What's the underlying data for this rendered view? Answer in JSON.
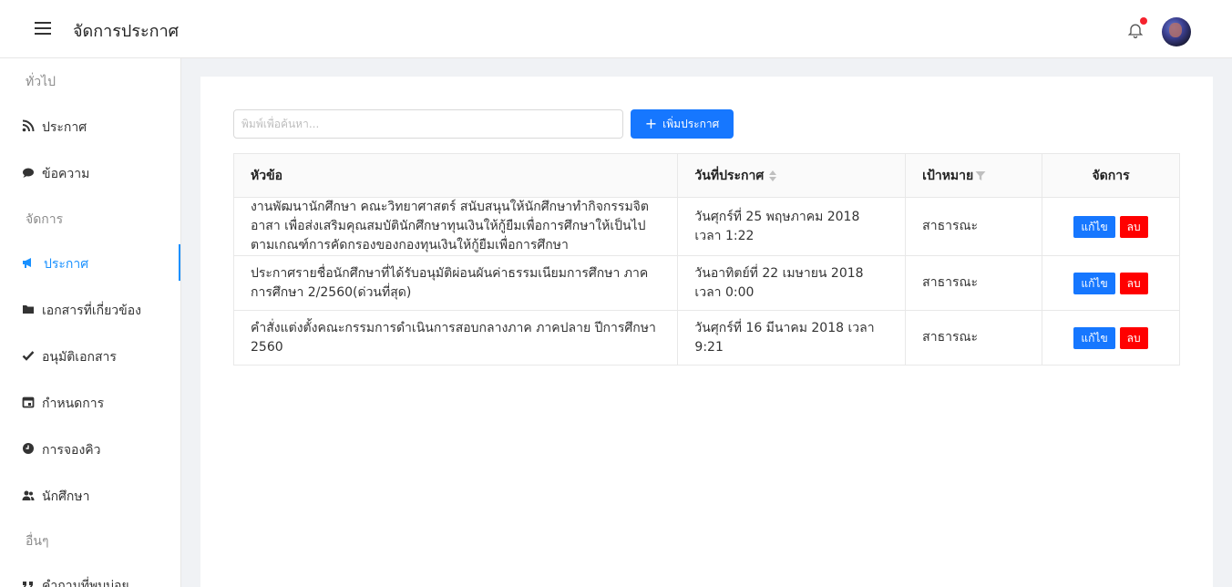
{
  "header": {
    "title": "จัดการประกาศ"
  },
  "sidebar": {
    "groups": [
      "ทั่วไป",
      "จัดการ",
      "อื่นๆ"
    ],
    "items": [
      {
        "label": "ประกาศ",
        "icon": "rss-icon"
      },
      {
        "label": "ข้อความ",
        "icon": "message-icon"
      },
      {
        "label": "ประกาศ",
        "icon": "megaphone-icon",
        "active": true
      },
      {
        "label": "เอกสารที่เกี่ยวข้อง",
        "icon": "folder-icon"
      },
      {
        "label": "อนุมัติเอกสาร",
        "icon": "check-icon"
      },
      {
        "label": "กำหนดการ",
        "icon": "calendar-icon"
      },
      {
        "label": "การจองคิว",
        "icon": "clock-icon"
      },
      {
        "label": "นักศึกษา",
        "icon": "users-icon"
      },
      {
        "label": "คำถามที่พบบ่อย",
        "icon": "quote-icon"
      }
    ]
  },
  "toolbar": {
    "search_placeholder": "พิมพ์เพื่อค้นหา...",
    "add_label": "เพิ่มประกาศ"
  },
  "table": {
    "headers": [
      "หัวข้อ",
      "วันที่ประกาศ",
      "เป้าหมาย",
      "จัดการ"
    ],
    "edit_label": "แก้ไข",
    "delete_label": "ลบ",
    "rows": [
      {
        "title": "งานพัฒนานักศึกษา คณะวิทยาศาสตร์ สนับสนุนให้นักศึกษาทำกิจกรรมจิตอาสา เพื่อส่งเสริมคุณสมบัตินักศึกษาทุนเงินให้กู้ยืมเพื่อการศึกษาให้เป็นไปตามเกณฑ์การคัดกรองของกองทุนเงินให้กู้ยืมเพื่อการศึกษา",
        "date": "วันศุกร์ที่ 25 พฤษภาคม 2018 เวลา 1:22",
        "target": "สาธารณะ"
      },
      {
        "title": "ประกาศรายชื่อนักศึกษาที่ได้รับอนุมัติผ่อนผันค่าธรรมเนียมการศึกษา ภาคการศึกษา 2/2560(ด่วนที่สุด)",
        "date": "วันอาทิตย์ที่ 22 เมษายน 2018 เวลา 0:00",
        "target": "สาธารณะ"
      },
      {
        "title": "คำสั่งแต่งตั้งคณะกรรมการดำเนินการสอบกลางภาค ภาคปลาย ปีการศึกษา 2560",
        "date": "วันศุกร์ที่ 16 มีนาคม 2018 เวลา 9:21",
        "target": "สาธารณะ"
      }
    ]
  },
  "colors": {
    "primary": "#1677ff",
    "danger": "#ff0000",
    "notification_dot": "#f5222d"
  }
}
